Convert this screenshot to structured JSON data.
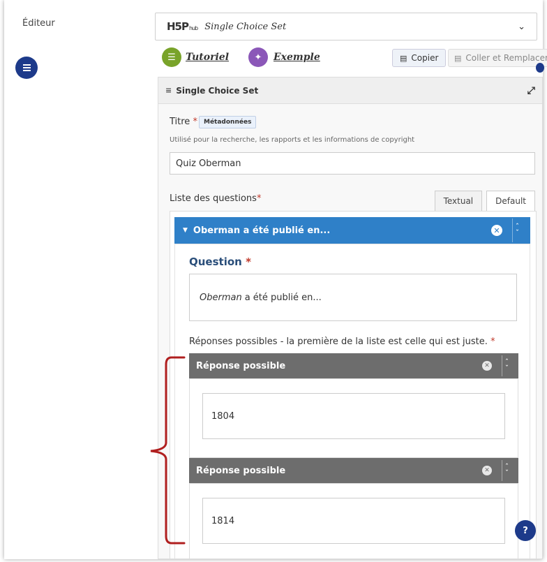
{
  "sidebar": {
    "label": "Éditeur"
  },
  "selector": {
    "logo": "H5P",
    "logo_small": "hub",
    "library": "Single Choice Set",
    "chevron": "⌄"
  },
  "toolbar": {
    "tutorial_label": "Tutoriel",
    "example_label": "Exemple",
    "copy_label": "Copier",
    "paste_label": "Coller et Remplacer"
  },
  "content_title": "Single Choice Set",
  "title_field": {
    "label": "Titre",
    "metadata_label": "Métadonnées",
    "description": "Utilisé pour la recherche, les rapports et les informations de copyright",
    "value": "Quiz Oberman"
  },
  "questions": {
    "label": "Liste des questions",
    "tabs": [
      "Textual",
      "Default"
    ],
    "active_tab": "Default",
    "item": {
      "header": "Oberman a été publié en...",
      "question_label": "Question",
      "question_italic": "Oberman",
      "question_rest": "a été publié en...",
      "answers_label": "Réponses possibles - la première de la liste est celle qui est juste.",
      "answers": [
        {
          "header": "Réponse possible",
          "value": "1804"
        },
        {
          "header": "Réponse possible",
          "value": "1814"
        }
      ]
    }
  },
  "required_mark": "*",
  "help_label": "?",
  "colors": {
    "accent": "#2f80c8",
    "navy": "#1d3a8a",
    "answer_header": "#6d6d6d",
    "brace": "#b01f1f",
    "tutorial_icon": "#79a32a",
    "example_icon": "#8b57b8"
  }
}
